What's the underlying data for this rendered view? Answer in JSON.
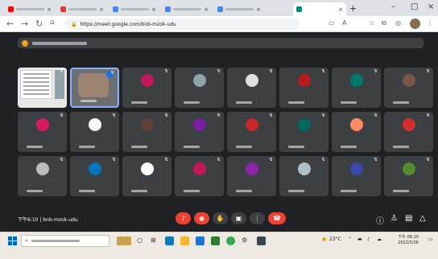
{
  "browser": {
    "tabs": [
      {
        "id": "youtube",
        "title": "",
        "favicon_color": "#ff0000"
      },
      {
        "id": "news",
        "title": "",
        "favicon_color": "#e53935"
      },
      {
        "id": "tab3",
        "title": "",
        "favicon_color": "#4285f4"
      },
      {
        "id": "tab4",
        "title": "",
        "favicon_color": "#4285f4"
      },
      {
        "id": "tab5",
        "title": "",
        "favicon_color": "#4285f4"
      },
      {
        "id": "meet",
        "title": "",
        "favicon_color": "#00897b",
        "active": true
      }
    ],
    "url": "https://meet.google.com/bnb-mzok-udu"
  },
  "meet": {
    "banner_text": "",
    "meeting_time": "下午6:10",
    "separator": "|",
    "meeting_code": "bnb-mzok-udu",
    "people_count": "",
    "tiles": [
      {
        "type": "share"
      },
      {
        "type": "self",
        "label": ""
      },
      {
        "type": "avatar",
        "color": "#c2185b",
        "initial": "",
        "label": ""
      },
      {
        "type": "photo",
        "color": "#90a4ae",
        "label": ""
      },
      {
        "type": "photo",
        "color": "#e0e0e0",
        "label": ""
      },
      {
        "type": "avatar",
        "color": "#b71c1c",
        "initial": "",
        "label": ""
      },
      {
        "type": "avatar",
        "color": "#00796b",
        "initial": "",
        "label": ""
      },
      {
        "type": "photo",
        "color": "#795548",
        "label": ""
      },
      {
        "type": "avatar",
        "color": "#d81b60",
        "initial": "",
        "label": ""
      },
      {
        "type": "photo",
        "color": "#f5f5f5",
        "label": ""
      },
      {
        "type": "avatar",
        "color": "#5d4037",
        "initial": "",
        "label": ""
      },
      {
        "type": "avatar",
        "color": "#7b1fa2",
        "initial": "",
        "label": ""
      },
      {
        "type": "avatar",
        "color": "#c62828",
        "initial": "",
        "label": ""
      },
      {
        "type": "avatar",
        "color": "#00695c",
        "initial": "",
        "label": ""
      },
      {
        "type": "photo",
        "color": "#ff8a65",
        "label": ""
      },
      {
        "type": "avatar",
        "color": "#d32f2f",
        "initial": "",
        "label": ""
      },
      {
        "type": "photo",
        "color": "#bdbdbd",
        "label": ""
      },
      {
        "type": "avatar",
        "color": "#0277bd",
        "initial": "",
        "label": ""
      },
      {
        "type": "photo",
        "color": "#ffffff",
        "label": ""
      },
      {
        "type": "avatar",
        "color": "#c2185b",
        "initial": "",
        "label": ""
      },
      {
        "type": "avatar",
        "color": "#8e24aa",
        "initial": "",
        "label": ""
      },
      {
        "type": "photo",
        "color": "#b0bec5",
        "label": ""
      },
      {
        "type": "avatar",
        "color": "#3949ab",
        "initial": "",
        "label": ""
      },
      {
        "type": "avatar",
        "color": "#558b2f",
        "initial": "",
        "label": ""
      }
    ]
  },
  "taskbar": {
    "search_placeholder": "",
    "weather": "23°C",
    "time": "下午 06:10",
    "date": "2022/5/26"
  },
  "colors": {
    "meet_bg": "#202124",
    "tile_bg": "#3c4043",
    "end_call": "#ea4335",
    "accent": "#8ab4f8"
  }
}
